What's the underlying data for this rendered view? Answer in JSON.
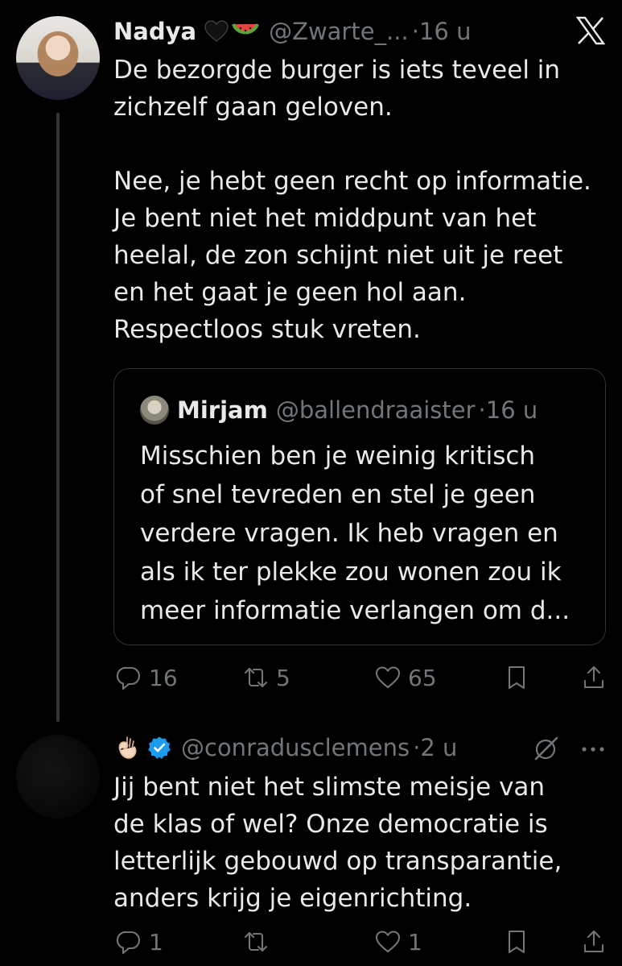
{
  "tweet": {
    "author_name": "Nadya",
    "author_handle": "@Zwarte_...",
    "sep": "·",
    "time": "16 u",
    "text": "De bezorgde burger is iets teveel in\nzichzelf gaan geloven.\n\nNee, je hebt geen recht op informatie.\nJe bent niet het middpunt van het\nheelal, de zon schijnt niet uit je reet\nen het gaat je geen hol aan.\nRespectloos stuk vreten.",
    "name_emojis": [
      "black-heart-icon",
      "watermelon-icon"
    ],
    "quote": {
      "author_name": "Mirjam",
      "author_handle": "@ballendraaister",
      "sep": "·",
      "time": "16 u",
      "text": "Misschien ben je weinig kritisch\nof snel tevreden en stel je geen\nverdere vragen. Ik heb vragen en\nals ik ter plekke zou wonen zou ik\nmeer informatie verlangen om d..."
    },
    "actions": {
      "replies": "16",
      "retweets": "5",
      "likes": "65"
    }
  },
  "reply": {
    "author_handle": "@conradusclemens",
    "sep": "·",
    "time": "2 u",
    "name_icons": [
      "ok-hand-icon",
      "verified-badge-icon"
    ],
    "text": "Jij bent niet het slimste meisje van\nde klas of wel? Onze democratie is\nletterlijk gebouwd op transparantie,\nanders krijg je eigenrichting.",
    "actions": {
      "replies": "1",
      "retweets": "",
      "likes": "1"
    }
  },
  "colors": {
    "background": "#000000",
    "text": "#e7e9ea",
    "muted": "#71767b",
    "verified": "#1d9bf0",
    "border": "#2f3336"
  }
}
